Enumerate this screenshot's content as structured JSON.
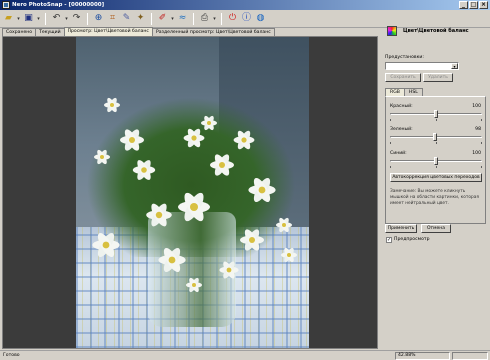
{
  "window": {
    "title": "Nero PhotoSnap - [00000000]"
  },
  "toolbar": {
    "icons": [
      "open-folder-icon",
      "save-icon",
      "undo-icon",
      "redo-icon",
      "zoom-icon",
      "crop-icon",
      "brush-icon",
      "color-icon",
      "red-eye-icon",
      "print-icon",
      "exit-icon",
      "help-icon",
      "web-icon"
    ]
  },
  "tabs": [
    {
      "label": "Сохранено"
    },
    {
      "label": "Текущий"
    },
    {
      "label": "Просмотр: Цвет\\Цветовой баланс",
      "active": true
    },
    {
      "label": "Разделенный просмотр: Цвет\\Цветовой баланс"
    }
  ],
  "panel": {
    "title": "Цвет\\Цветовой баланс",
    "presets_label": "Предустановки:",
    "save_label": "Сохранить",
    "delete_label": "Удалить",
    "tab_rgb": "RGB",
    "tab_hsl": "HSL",
    "red_label": "Красный:",
    "red_value": "100",
    "green_label": "Зеленый:",
    "green_value": "98",
    "blue_label": "Синий:",
    "blue_value": "100",
    "auto_button": "Автокоррекция цветовых переходов",
    "note": "Замечание: Вы можете кликнуть мышкой на области картинки, которая имеет нейтральный цвет.",
    "apply_label": "Применить",
    "cancel_label": "Отмена",
    "preview_label": "Предпросмотр",
    "preview_checked": true
  },
  "status": {
    "text": "Готово",
    "zoom": "42.88%"
  }
}
